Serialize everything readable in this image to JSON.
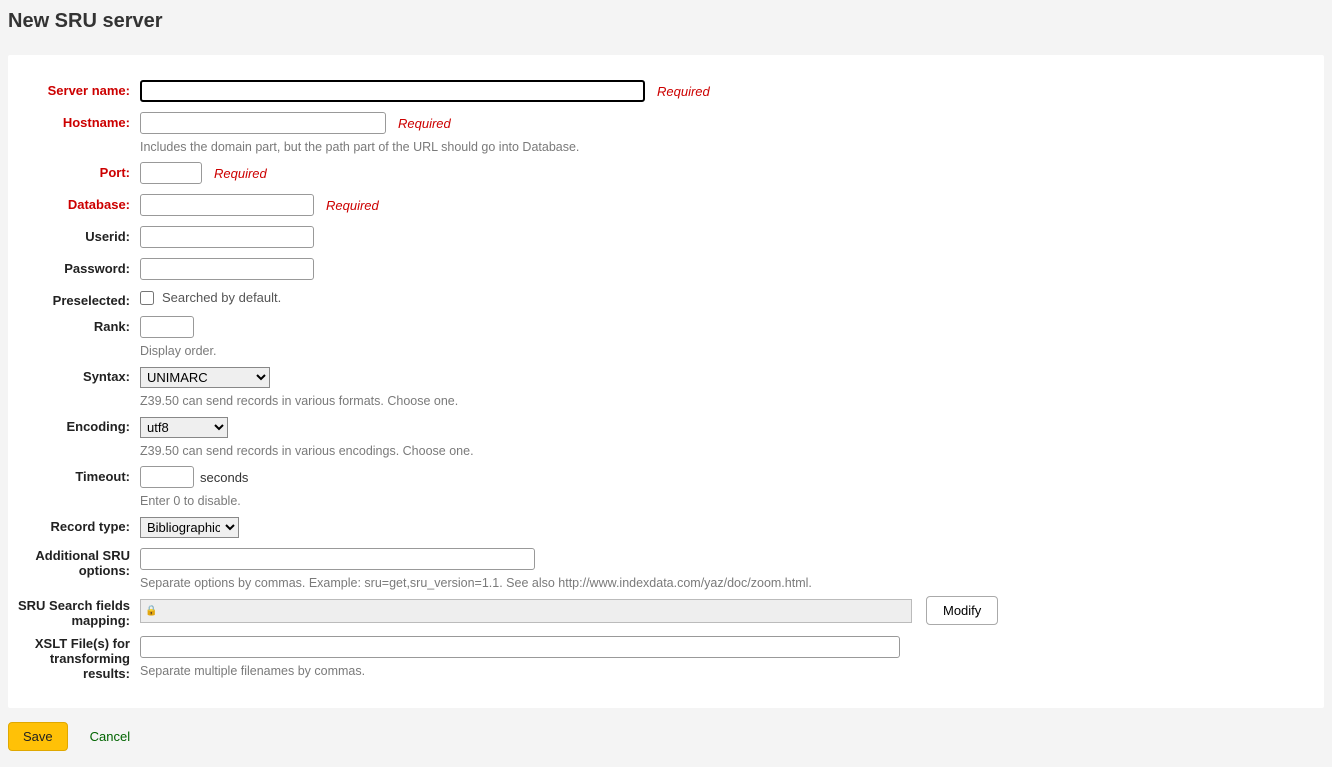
{
  "page": {
    "title": "New SRU server"
  },
  "form": {
    "server_name": {
      "label": "Server name:",
      "required_text": "Required",
      "value": ""
    },
    "hostname": {
      "label": "Hostname:",
      "required_text": "Required",
      "value": "",
      "hint": "Includes the domain part, but the path part of the URL should go into Database."
    },
    "port": {
      "label": "Port:",
      "required_text": "Required",
      "value": ""
    },
    "database": {
      "label": "Database:",
      "required_text": "Required",
      "value": ""
    },
    "userid": {
      "label": "Userid:",
      "value": ""
    },
    "password": {
      "label": "Password:",
      "value": ""
    },
    "preselected": {
      "label": "Preselected:",
      "checkbox_label": "Searched by default.",
      "checked": false
    },
    "rank": {
      "label": "Rank:",
      "value": "",
      "hint": "Display order."
    },
    "syntax": {
      "label": "Syntax:",
      "value": "UNIMARC",
      "hint": "Z39.50 can send records in various formats. Choose one."
    },
    "encoding": {
      "label": "Encoding:",
      "value": "utf8",
      "hint": "Z39.50 can send records in various encodings. Choose one."
    },
    "timeout": {
      "label": "Timeout:",
      "value": "",
      "suffix": "seconds",
      "hint": "Enter 0 to disable."
    },
    "record_type": {
      "label": "Record type:",
      "value": "Bibliographic"
    },
    "sru_options": {
      "label": "Additional SRU options:",
      "value": "",
      "hint": "Separate options by commas. Example: sru=get,sru_version=1.1. See also http://www.indexdata.com/yaz/doc/zoom.html."
    },
    "sru_mapping": {
      "label": "SRU Search fields mapping:",
      "value": "",
      "modify_label": "Modify"
    },
    "xslt": {
      "label": "XSLT File(s) for transforming results:",
      "value": "",
      "hint": "Separate multiple filenames by commas."
    }
  },
  "footer": {
    "save": "Save",
    "cancel": "Cancel"
  }
}
